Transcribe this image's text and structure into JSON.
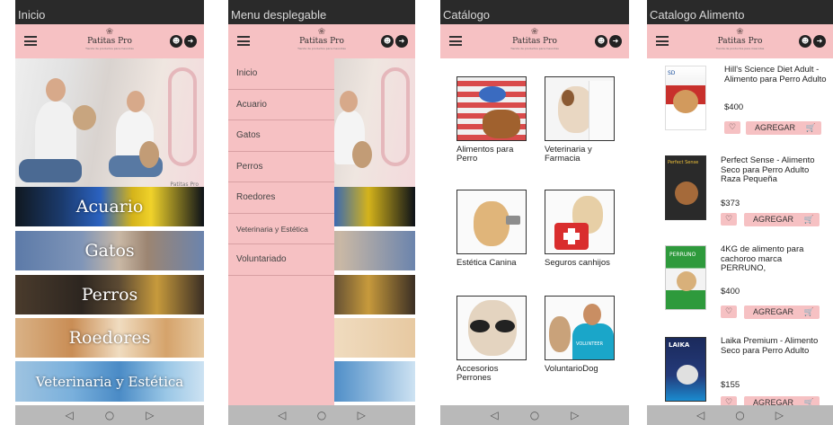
{
  "frames": [
    {
      "title": "Inicio"
    },
    {
      "title": "Menu desplegable"
    },
    {
      "title": "Catálogo"
    },
    {
      "title": "Catalogo Alimento"
    }
  ],
  "brand": {
    "name": "Patitas Pro",
    "tagline": "Tienda de productos para mascotas",
    "paw": "❀"
  },
  "header_icons": {
    "user": "☻",
    "cart": "➜"
  },
  "navbar": {
    "back": "◁",
    "home": "○",
    "recent": "▷"
  },
  "home": {
    "hero_watermark": "Patitas Pro",
    "carousel_dots": "● ● ●",
    "categories": [
      "Acuario",
      "Gatos",
      "Perros",
      "Roedores",
      "Veterinaria y Estética"
    ]
  },
  "menu": {
    "items": [
      "Inicio",
      "Acuario",
      "Gatos",
      "Perros",
      "Roedores",
      "Veterinaria y Estética",
      "Voluntariado"
    ]
  },
  "catalog": {
    "items": [
      {
        "label": "Alimentos para Perro"
      },
      {
        "label": "Veterinaria y Farmacia"
      },
      {
        "label": "Estética Canina"
      },
      {
        "label": "Seguros canhijos"
      },
      {
        "label": "Accesorios Perrones"
      },
      {
        "label": "VoluntarioDog"
      }
    ],
    "volunteer_shirt": "VOLUNTEER"
  },
  "food": {
    "add_label": "AGREGAR",
    "heart": "♡",
    "cart_icon": "🛒",
    "products": [
      {
        "name": "Hill's Science Diet Adult - Alimento para Perro Adulto",
        "price": "$400",
        "pkg": "SD"
      },
      {
        "name": "Perfect Sense - Alimento Seco para Perro Adulto Raza Pequeña",
        "price": "$373",
        "pkg": "Perfect Sense"
      },
      {
        "name": "4KG de alimento para cachoroo marca PERRUNO,",
        "price": "$400",
        "pkg": "PERRUNO"
      },
      {
        "name": "Laika Premium - Alimento Seco para Perro Adulto",
        "price": "$155",
        "pkg": "LAIKA"
      }
    ]
  },
  "colors": {
    "accent": "#f6c1c3",
    "frame_bg": "#2a2a2a",
    "navbar": "#b9b9b9"
  }
}
